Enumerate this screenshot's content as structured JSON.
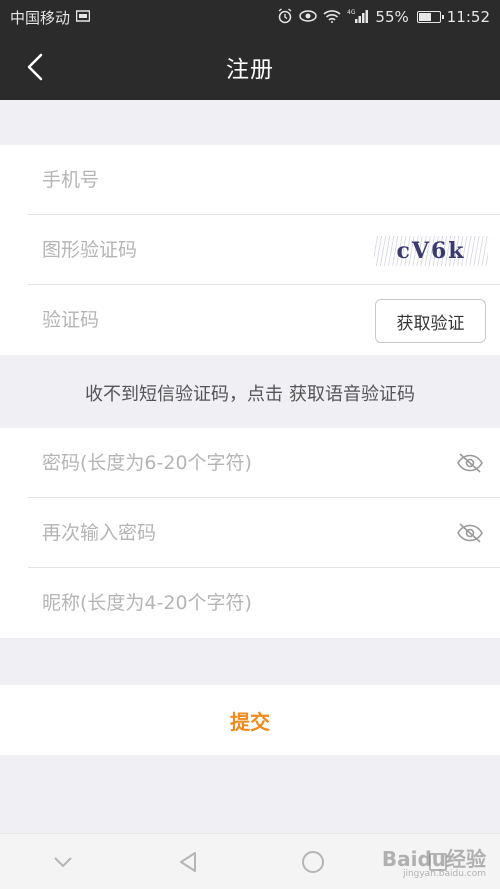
{
  "status_bar": {
    "carrier": "中国移动",
    "network": "4G",
    "battery": "55%",
    "battery_level": 0.55,
    "time": "11:52"
  },
  "nav": {
    "title": "注册"
  },
  "form": {
    "phone_placeholder": "手机号",
    "captcha_placeholder": "图形验证码",
    "captcha_text": "cV6k",
    "sms_code_placeholder": "验证码",
    "get_code_label": "获取验证",
    "voice_hint_prefix": "收不到短信验证码，点击",
    "voice_hint_link": "获取语音验证码",
    "password_placeholder": "密码(长度为6-20个字符)",
    "confirm_password_placeholder": "再次输入密码",
    "nickname_placeholder": "昵称(长度为4-20个字符)"
  },
  "submit_label": "提交",
  "watermark": {
    "text": "Baidu经验",
    "sub": "jingyan.baidu.com"
  },
  "colors": {
    "bar_bg": "#2b2b2b",
    "page_bg": "#efeff4",
    "accent": "#f08b1e"
  }
}
